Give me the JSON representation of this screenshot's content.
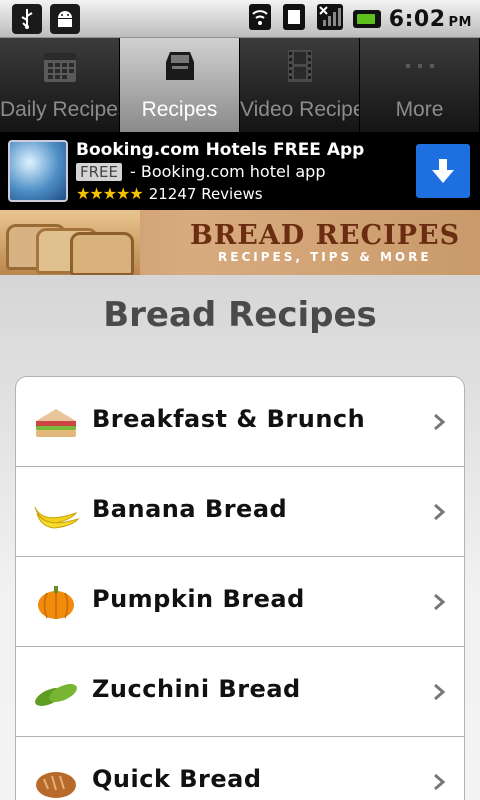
{
  "status_bar": {
    "time": "6:02",
    "ampm": "PM",
    "left_icons": [
      "usb-icon",
      "android-icon"
    ],
    "right_icons": [
      "wifi-icon",
      "sim-icon",
      "no-signal-icon",
      "battery-icon"
    ]
  },
  "tabs": [
    {
      "label": "Daily Recipes",
      "icon": "calendar-icon",
      "active": false
    },
    {
      "label": "Recipes",
      "icon": "recipe-box-icon",
      "active": true
    },
    {
      "label": "Video Recipe",
      "icon": "film-icon",
      "active": false
    },
    {
      "label": "More",
      "icon": "more-dots-icon",
      "active": false
    }
  ],
  "ad": {
    "title": "Booking.com Hotels FREE App",
    "free_badge": "FREE",
    "subtitle": "- Booking.com hotel app",
    "stars": "★★★★★",
    "reviews": "21247 Reviews",
    "accent": "#1e6fe0"
  },
  "banner": {
    "title": "BREAD RECIPES",
    "subtitle": "RECIPES, TIPS & MORE"
  },
  "page": {
    "title": "Bread Recipes"
  },
  "recipe_list": [
    {
      "label": "Breakfast & Brunch",
      "icon": "sandwich-icon"
    },
    {
      "label": "Banana Bread",
      "icon": "banana-icon"
    },
    {
      "label": "Pumpkin Bread",
      "icon": "pumpkin-icon"
    },
    {
      "label": "Zucchini Bread",
      "icon": "zucchini-icon"
    },
    {
      "label": "Quick Bread",
      "icon": "bread-loaf-icon"
    }
  ]
}
